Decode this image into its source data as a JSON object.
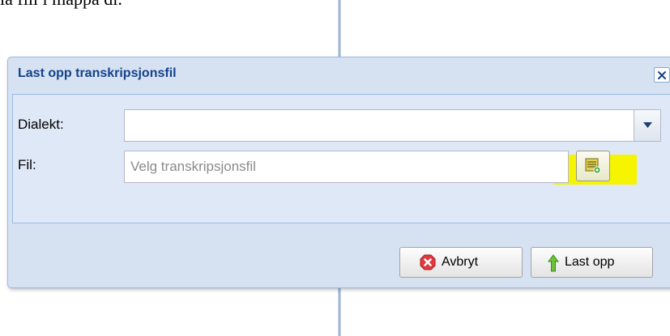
{
  "background": {
    "doc_text": "lå fill i mappa di."
  },
  "dialog": {
    "title": "Last opp transkripsjonsfil",
    "close_icon": "close-x-icon",
    "accent_color": "#15428b",
    "fields": {
      "dialect": {
        "label": "Dialekt:",
        "value": "",
        "trigger_icon": "chevron-down-icon"
      },
      "file": {
        "label": "Fil:",
        "placeholder": "Velg transkripsjonsfil",
        "value": "",
        "browse_icon": "browse-file-icon",
        "highlight_color": "#f6f400"
      }
    },
    "buttons": {
      "cancel": {
        "label": "Avbryt",
        "icon": "cancel-x-icon",
        "icon_color": "#e0393e"
      },
      "upload": {
        "label": "Last opp",
        "icon": "arrow-up-icon",
        "icon_color": "#5bb02a"
      }
    }
  }
}
